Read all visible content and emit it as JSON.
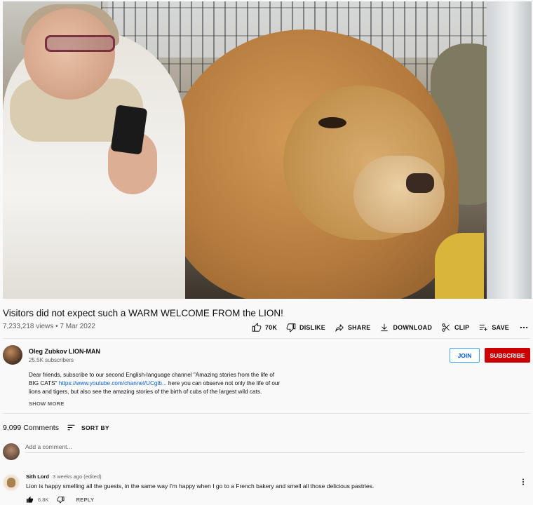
{
  "video": {
    "title": "Visitors did not expect such a WARM WELCOME FROM the LION!",
    "views": "7,233,218 views",
    "separator": "•",
    "date": "7 Mar 2022"
  },
  "actions": {
    "like": "70K",
    "dislike": "DISLIKE",
    "share": "SHARE",
    "download": "DOWNLOAD",
    "clip": "CLIP",
    "save": "SAVE"
  },
  "icons": {
    "like": "thumb-up-icon",
    "dislike": "thumb-down-icon",
    "share": "share-icon",
    "download": "download-icon",
    "clip": "scissors-icon",
    "save": "playlist-add-icon",
    "more": "more-horizontal-icon",
    "sort": "sort-icon",
    "comment_more": "more-vertical-icon"
  },
  "channel": {
    "name": "Oleg Zubkov LION-MAN",
    "subscribers": "25.5K subscribers",
    "join_label": "JOIN",
    "subscribe_label": "SUBSCRIBE"
  },
  "description": {
    "line1": "Dear friends, subscribe to our second English-language channel \"Amazing stories from the life of",
    "line2_prefix": "BIG CATS\"",
    "link": "https://www.youtube.com/channel/UCglb...",
    "line2_suffix": "here you can observe not only the life of our",
    "line3": "lions and tigers, but also see the amazing stories of the birth of cubs of the largest wild cats.",
    "show_more": "SHOW MORE"
  },
  "comments": {
    "count": "9,099 Comments",
    "sort_label": "SORT BY",
    "add_placeholder": "Add a comment...",
    "items": [
      {
        "author": "Sith Lord",
        "time": "3 weeks ago (edited)",
        "text": "Lion is happy smelling all the guests, in the same way I'm happy when I go to a French bakery and smell all those delicious pastries.",
        "likes": "6.8K",
        "reply_label": "REPLY"
      }
    ]
  },
  "colors": {
    "subscribe_bg": "#cc0000",
    "join_border": "#3ea6ff",
    "link": "#065fd4",
    "secondary_text": "#606060"
  }
}
